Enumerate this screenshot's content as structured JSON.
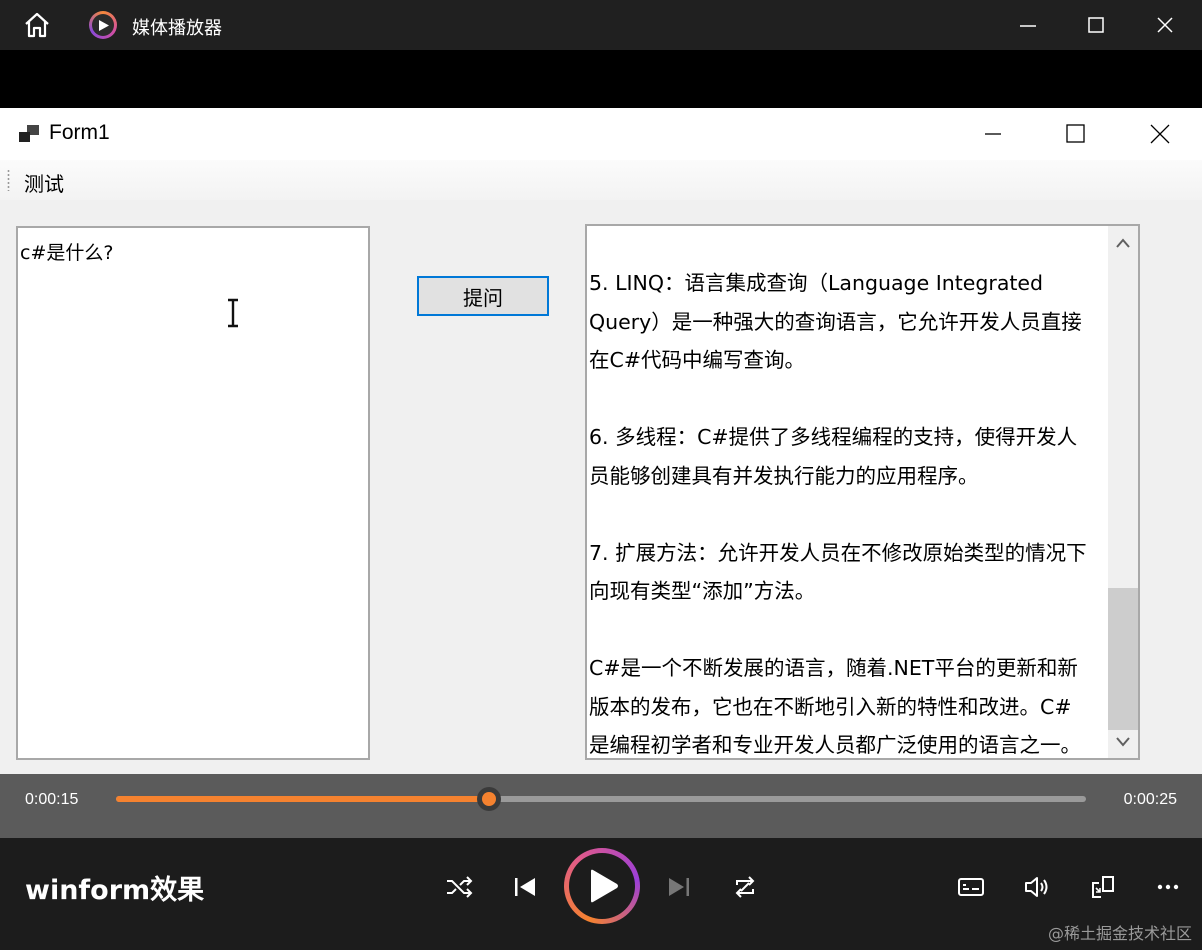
{
  "media_player": {
    "app_title": "媒体播放器",
    "media_title": "winform效果",
    "time_current": "0:00:15",
    "time_total": "0:00:25",
    "progress": 0.385,
    "accent_color": "#f5822f",
    "watermark": "@稀土掘金技术社区"
  },
  "form": {
    "title": "Form1",
    "menu": [
      "测试"
    ],
    "question_text": "c#是什么?",
    "ask_button_label": "提问",
    "answer_lines": [
      "5. LINQ：语言集成查询（Language Integrated",
      "Query）是一种强大的查询语言，它允许开发人员直接",
      "在C#代码中编写查询。",
      "",
      "6. 多线程：C#提供了多线程编程的支持，使得开发人",
      "员能够创建具有并发执行能力的应用程序。",
      "",
      "7. 扩展方法：允许开发人员在不修改原始类型的情况下",
      "向现有类型“添加”方法。",
      "",
      "C#是一个不断发展的语言，随着.NET平台的更新和新",
      "版本的发布，它也在不断地引入新的特性和改进。C#",
      "是编程初学者和专业开发人员都广泛使用的语言之一。"
    ]
  }
}
